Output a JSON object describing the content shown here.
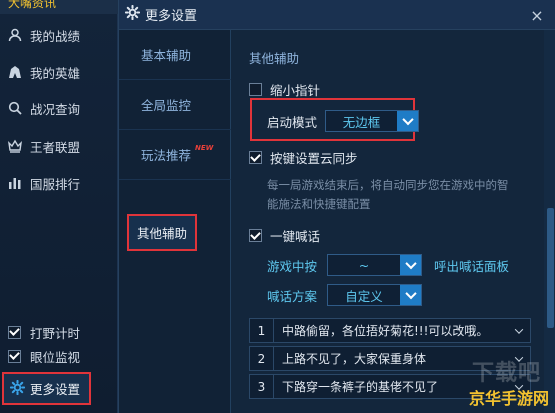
{
  "left_nav": {
    "top_strip_text": "大嘴资讯",
    "items": [
      {
        "label": "我的战绩",
        "icon": "user-icon"
      },
      {
        "label": "我的英雄",
        "icon": "hero-icon"
      },
      {
        "label": "战况查询",
        "icon": "search-icon"
      },
      {
        "label": "王者联盟",
        "icon": "crown-icon"
      },
      {
        "label": "国服排行",
        "icon": "bar-chart-icon"
      }
    ],
    "checks": [
      {
        "label": "打野计时",
        "checked": true
      },
      {
        "label": "眼位监视",
        "checked": true
      }
    ],
    "more_settings": "更多设置"
  },
  "dialog": {
    "title": "更多设置",
    "close": "×",
    "tabs": [
      {
        "label": "基本辅助"
      },
      {
        "label": "全局监控"
      },
      {
        "label": "玩法推荐",
        "badge": "NEW"
      },
      {
        "label": "其他辅助"
      }
    ],
    "content": {
      "section_title": "其他辅助",
      "shrink_pointer": {
        "label": "缩小指针",
        "checked": false
      },
      "launch_mode": {
        "label": "启动模式",
        "value": "无边框"
      },
      "cloud_sync": {
        "label": "按键设置云同步",
        "checked": true,
        "desc_line1": "每一局游戏结束后，将自动同步您在游戏中的智",
        "desc_line2": "能施法和快捷键配置"
      },
      "one_key_shout": {
        "label": "一键喊话",
        "checked": true
      },
      "in_game_key": {
        "label": "游戏中按",
        "value": "~",
        "suffix": "呼出喊话面板"
      },
      "shout_scheme": {
        "label": "喊话方案",
        "value": "自定义"
      },
      "shout_list": [
        {
          "num": "1",
          "text": "中路偷留，各位捂好菊花!!!可以改哦。"
        },
        {
          "num": "2",
          "text": "上路不见了，大家保重身体"
        },
        {
          "num": "3",
          "text": "下路穿一条裤子的基佬不见了"
        }
      ]
    }
  },
  "watermark": {
    "top": "下载吧",
    "bottom": "京华手游网"
  },
  "colors": {
    "highlight_red": "#e0343a",
    "accent_blue": "#1f7cc6",
    "accent_cyan": "#5ec8ef"
  }
}
